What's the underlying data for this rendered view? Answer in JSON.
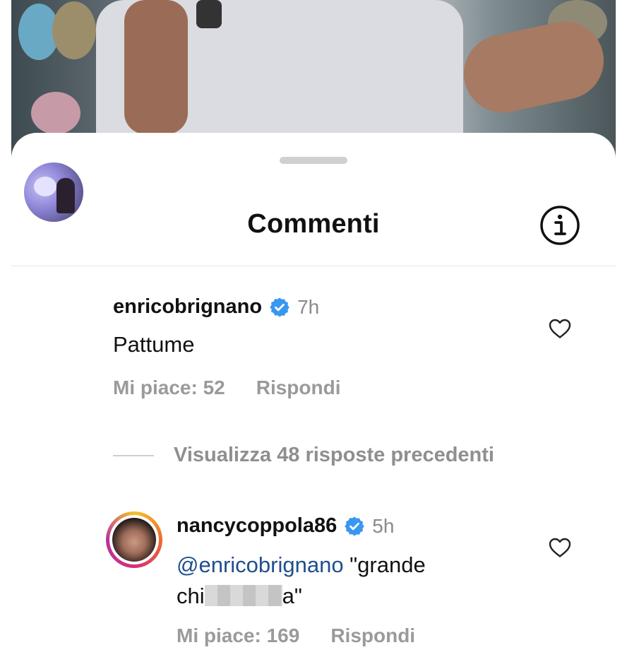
{
  "header": {
    "title": "Commenti"
  },
  "comments": [
    {
      "username": "enricobrignano",
      "time": "7h",
      "text": "Pattume",
      "likes": "Mi piace: 52",
      "reply": "Rispondi"
    },
    {
      "username": "nancycoppola86",
      "time": "5h",
      "mention": "@enricobrignano",
      "text_after_mention": " \"grande",
      "text_line2_start": "chi",
      "text_line2_end": "a\"",
      "likes": "Mi piace: 169",
      "reply": "Rispondi"
    }
  ],
  "view_replies": "Visualizza 48 risposte precedenti",
  "colors": {
    "verified": "#3897f0",
    "mention": "#1f4f8c",
    "muted": "#9a9a9a"
  },
  "icons": [
    "info-icon",
    "verified-badge-icon",
    "heart-icon"
  ]
}
